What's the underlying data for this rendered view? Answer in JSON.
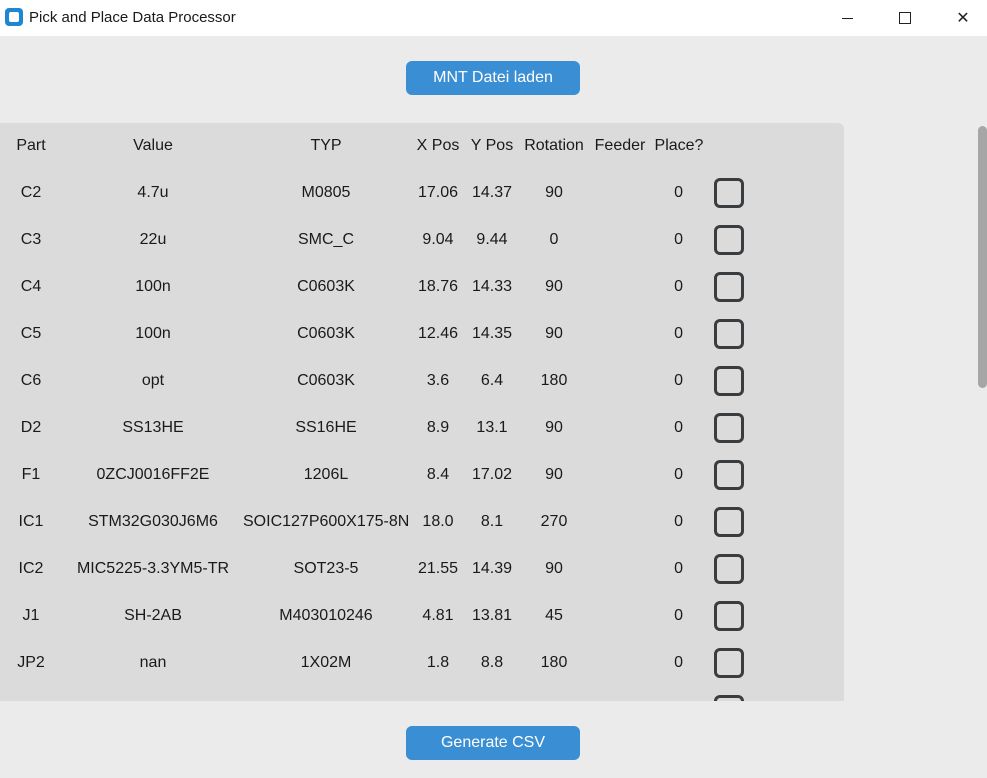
{
  "window": {
    "title": "Pick and Place Data Processor",
    "min_symbol": "—",
    "close_symbol": "✕"
  },
  "buttons": {
    "load_label": "MNT Datei laden",
    "generate_label": "Generate CSV"
  },
  "colors": {
    "button": "#3a8fd4",
    "panel": "#dbdbdb",
    "background": "#ebebeb"
  },
  "table": {
    "headers": [
      "Part",
      "Value",
      "TYP",
      "X Pos",
      "Y Pos",
      "Rotation",
      "Feeder",
      "Place?"
    ],
    "rows": [
      {
        "part": "C2",
        "value": "4.7u",
        "typ": "M0805",
        "x": "17.06",
        "y": "14.37",
        "rotation": "90",
        "feeder": "",
        "place": "0",
        "checked": false
      },
      {
        "part": "C3",
        "value": "22u",
        "typ": "SMC_C",
        "x": "9.04",
        "y": "9.44",
        "rotation": "0",
        "feeder": "",
        "place": "0",
        "checked": false
      },
      {
        "part": "C4",
        "value": "100n",
        "typ": "C0603K",
        "x": "18.76",
        "y": "14.33",
        "rotation": "90",
        "feeder": "",
        "place": "0",
        "checked": false
      },
      {
        "part": "C5",
        "value": "100n",
        "typ": "C0603K",
        "x": "12.46",
        "y": "14.35",
        "rotation": "90",
        "feeder": "",
        "place": "0",
        "checked": false
      },
      {
        "part": "C6",
        "value": "opt",
        "typ": "C0603K",
        "x": "3.6",
        "y": "6.4",
        "rotation": "180",
        "feeder": "",
        "place": "0",
        "checked": false
      },
      {
        "part": "D2",
        "value": "SS13HE",
        "typ": "SS16HE",
        "x": "8.9",
        "y": "13.1",
        "rotation": "90",
        "feeder": "",
        "place": "0",
        "checked": false
      },
      {
        "part": "F1",
        "value": "0ZCJ0016FF2E",
        "typ": "1206L",
        "x": "8.4",
        "y": "17.02",
        "rotation": "90",
        "feeder": "",
        "place": "0",
        "checked": false
      },
      {
        "part": "IC1",
        "value": "STM32G030J6M6",
        "typ": "SOIC127P600X175-8N",
        "x": "18.0",
        "y": "8.1",
        "rotation": "270",
        "feeder": "",
        "place": "0",
        "checked": false
      },
      {
        "part": "IC2",
        "value": "MIC5225-3.3YM5-TR",
        "typ": "SOT23-5",
        "x": "21.55",
        "y": "14.39",
        "rotation": "90",
        "feeder": "",
        "place": "0",
        "checked": false
      },
      {
        "part": "J1",
        "value": "SH-2AB",
        "typ": "M403010246",
        "x": "4.81",
        "y": "13.81",
        "rotation": "45",
        "feeder": "",
        "place": "0",
        "checked": false
      },
      {
        "part": "JP2",
        "value": "nan",
        "typ": "1X02M",
        "x": "1.8",
        "y": "8.8",
        "rotation": "180",
        "feeder": "",
        "place": "0",
        "checked": false
      }
    ]
  },
  "scrollbar": {
    "position_fraction": 0.0
  }
}
